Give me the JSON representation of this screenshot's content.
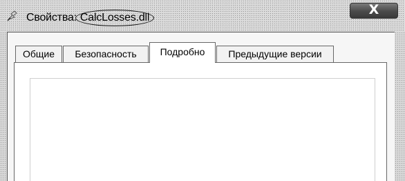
{
  "window": {
    "title_prefix": "Свойства:",
    "title_filename": "CalcLosses.dll",
    "close_label": "X"
  },
  "tabs": [
    {
      "label": "Общие"
    },
    {
      "label": "Безопасность"
    },
    {
      "label": "Подробно"
    },
    {
      "label": "Предыдущие версии"
    }
  ],
  "active_tab": "Подробно"
}
